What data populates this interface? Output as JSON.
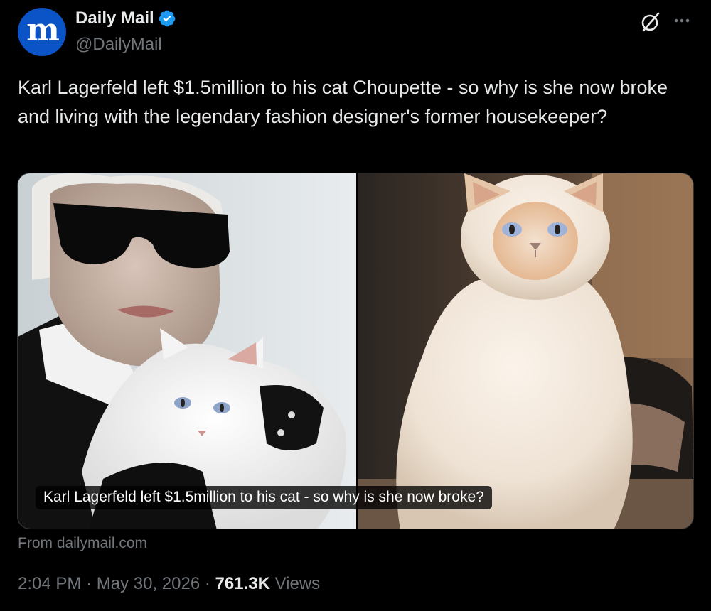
{
  "author": {
    "display_name": "Daily Mail",
    "handle": "@DailyMail",
    "avatar_letter": "m",
    "avatar_color": "#0b54c7",
    "verified": true,
    "verified_color": "#1d9bf0"
  },
  "header_actions": {
    "grok_icon": "grok-slash-circle-icon",
    "more_icon": "more-dots-icon"
  },
  "tweet": {
    "text": "Karl Lagerfeld left $1.5million to his cat Choupette - so why is she now broke and living with the legendary fashion designer's former housekeeper?"
  },
  "media": {
    "caption": "Karl Lagerfeld left $1.5million to his cat - so why is she now broke?",
    "source": "From dailymail.com",
    "left_image": "man-with-sunglasses-holding-white-cat",
    "right_image": "fluffy-white-cat-sitting"
  },
  "meta": {
    "time": "2:04 PM",
    "separator": "·",
    "date": "May 30, 2026",
    "views_count": "761.3K",
    "views_label": "Views"
  },
  "colors": {
    "background": "#000000",
    "text": "#e7e9ea",
    "secondary_text": "#71767b",
    "border": "#2f3336"
  }
}
